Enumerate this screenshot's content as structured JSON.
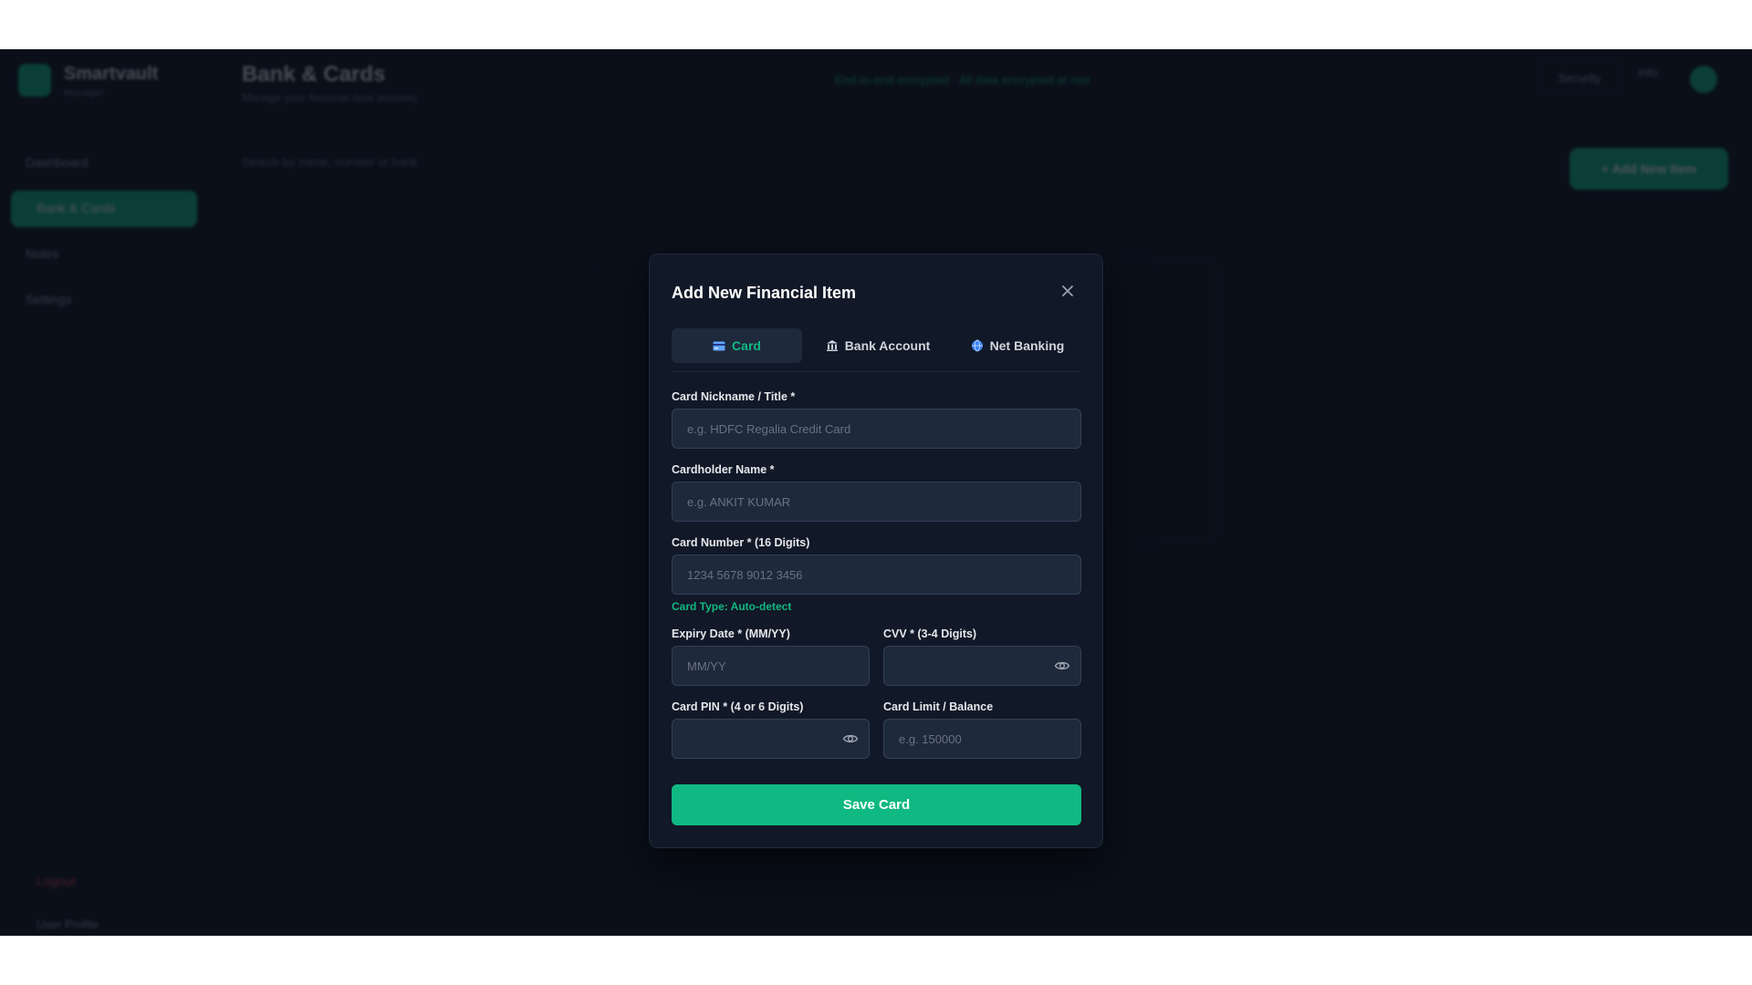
{
  "background_app": {
    "logo_title": "Smartvault",
    "logo_subtitle": "Manager",
    "page_title": "Bank & Cards",
    "page_subtitle": "Manage your financial data securely",
    "topbar_note": "End-to-end encrypted · All data encrypted at rest",
    "topbar_button": "Security",
    "topbar_ghost": "Info",
    "sidebar_items": [
      "Dashboard",
      "Bank & Cards",
      "Notes",
      "Settings"
    ],
    "sidebar_logout": "Logout",
    "sidebar_user": "User Profile",
    "search_placeholder": "Search by name, number or bank",
    "add_button": "+ Add New Item"
  },
  "modal": {
    "title": "Add New Financial Item",
    "tabs": [
      {
        "label": "Card",
        "icon": "credit-card-icon",
        "active": true
      },
      {
        "label": "Bank Account",
        "icon": "bank-icon",
        "active": false
      },
      {
        "label": "Net Banking",
        "icon": "globe-icon",
        "active": false
      }
    ],
    "fields": {
      "nickname": {
        "label": "Card Nickname / Title *",
        "placeholder": "e.g. HDFC Regalia Credit Card",
        "value": ""
      },
      "holder": {
        "label": "Cardholder Name *",
        "placeholder": "e.g. ANKIT KUMAR",
        "value": ""
      },
      "number": {
        "label": "Card Number * (16 Digits)",
        "placeholder": "1234 5678 9012 3456",
        "value": ""
      },
      "card_type_hint": "Card Type: Auto-detect",
      "expiry": {
        "label": "Expiry Date * (MM/YY)",
        "placeholder": "MM/YY",
        "value": ""
      },
      "cvv": {
        "label": "CVV * (3-4 Digits)",
        "placeholder": "",
        "value": ""
      },
      "pin": {
        "label": "Card PIN * (4 or 6 Digits)",
        "placeholder": "",
        "value": ""
      },
      "limit": {
        "label": "Card Limit / Balance",
        "placeholder": "e.g. 150000",
        "value": ""
      }
    },
    "save_label": "Save Card"
  },
  "colors": {
    "accent": "#10b981",
    "modal_bg": "#111827",
    "input_bg": "#1e293b",
    "page_bg": "#0a0f1a"
  }
}
